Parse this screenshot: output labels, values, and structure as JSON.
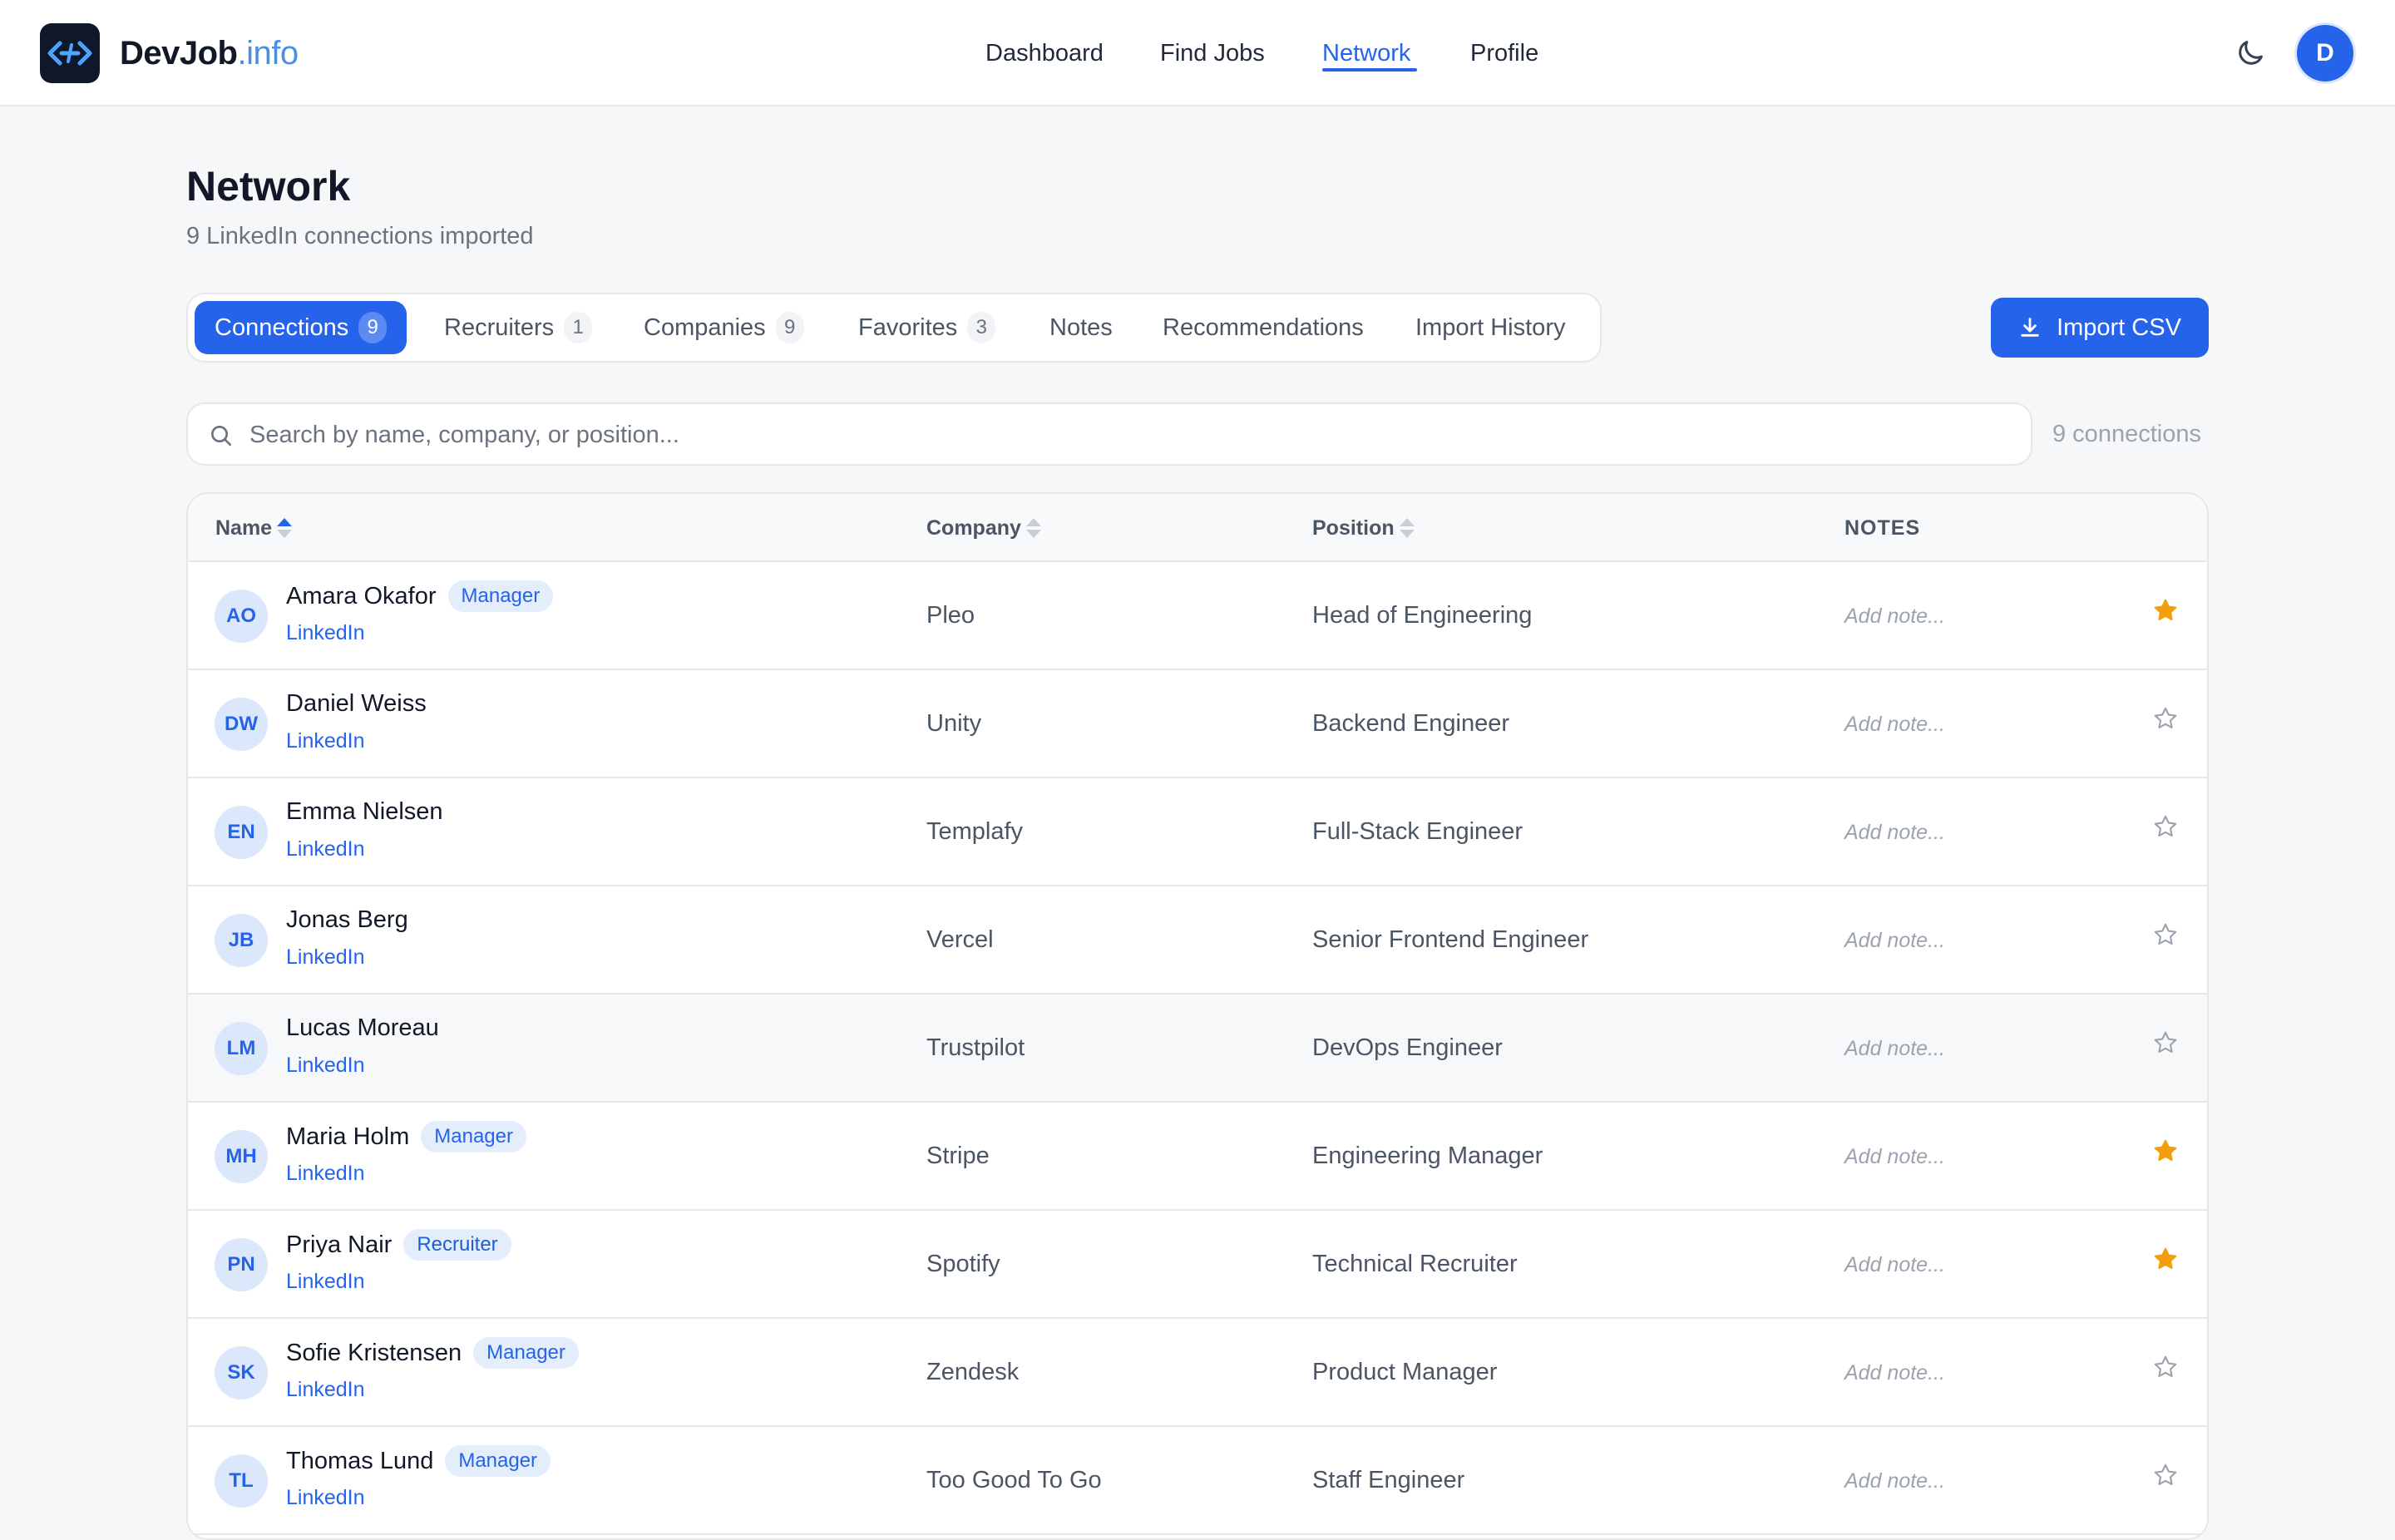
{
  "app": {
    "brand_main": "DevJob",
    "brand_tld": ".info",
    "user_initial": "D"
  },
  "nav": {
    "items": [
      {
        "label": "Dashboard"
      },
      {
        "label": "Find Jobs"
      },
      {
        "label": "Network",
        "active": true
      },
      {
        "label": "Profile"
      }
    ]
  },
  "page": {
    "title": "Network",
    "subtitle": "9 LinkedIn connections imported"
  },
  "tabs": [
    {
      "label": "Connections",
      "count": "9",
      "active": true
    },
    {
      "label": "Recruiters",
      "count": "1"
    },
    {
      "label": "Companies",
      "count": "9"
    },
    {
      "label": "Favorites",
      "count": "3"
    },
    {
      "label": "Notes"
    },
    {
      "label": "Recommendations"
    },
    {
      "label": "Import History"
    }
  ],
  "import_button": {
    "label": "Import CSV"
  },
  "search": {
    "placeholder": "Search by name, company, or position...",
    "value": ""
  },
  "connections_count": "9 connections",
  "table": {
    "headers": {
      "name": "Name",
      "company": "Company",
      "position": "Position",
      "notes": "NOTES"
    },
    "note_placeholder": "Add note...",
    "link_label": "LinkedIn",
    "rows": [
      {
        "initials": "AO",
        "name": "Amara Okafor",
        "badge": "Manager",
        "company": "Pleo",
        "position": "Head of Engineering",
        "favorite": true
      },
      {
        "initials": "DW",
        "name": "Daniel Weiss",
        "badge": "",
        "company": "Unity",
        "position": "Backend Engineer",
        "favorite": false
      },
      {
        "initials": "EN",
        "name": "Emma Nielsen",
        "badge": "",
        "company": "Templafy",
        "position": "Full-Stack Engineer",
        "favorite": false
      },
      {
        "initials": "JB",
        "name": "Jonas Berg",
        "badge": "",
        "company": "Vercel",
        "position": "Senior Frontend Engineer",
        "favorite": false
      },
      {
        "initials": "LM",
        "name": "Lucas Moreau",
        "badge": "",
        "company": "Trustpilot",
        "position": "DevOps Engineer",
        "favorite": false
      },
      {
        "initials": "MH",
        "name": "Maria Holm",
        "badge": "Manager",
        "company": "Stripe",
        "position": "Engineering Manager",
        "favorite": true
      },
      {
        "initials": "PN",
        "name": "Priya Nair",
        "badge": "Recruiter",
        "company": "Spotify",
        "position": "Technical Recruiter",
        "favorite": true
      },
      {
        "initials": "SK",
        "name": "Sofie Kristensen",
        "badge": "Manager",
        "company": "Zendesk",
        "position": "Product Manager",
        "favorite": false
      },
      {
        "initials": "TL",
        "name": "Thomas Lund",
        "badge": "Manager",
        "company": "Too Good To Go",
        "position": "Staff Engineer",
        "favorite": false
      }
    ]
  },
  "colors": {
    "accent": "#2563eb",
    "star_active": "#f59e0b",
    "star_inactive": "#9ca3af"
  },
  "icons": {
    "logo": "code-arrows-icon",
    "theme": "moon-icon",
    "search": "search-icon",
    "import": "download-icon",
    "favorite": "star-icon",
    "sort": "sort-arrows-icon"
  }
}
